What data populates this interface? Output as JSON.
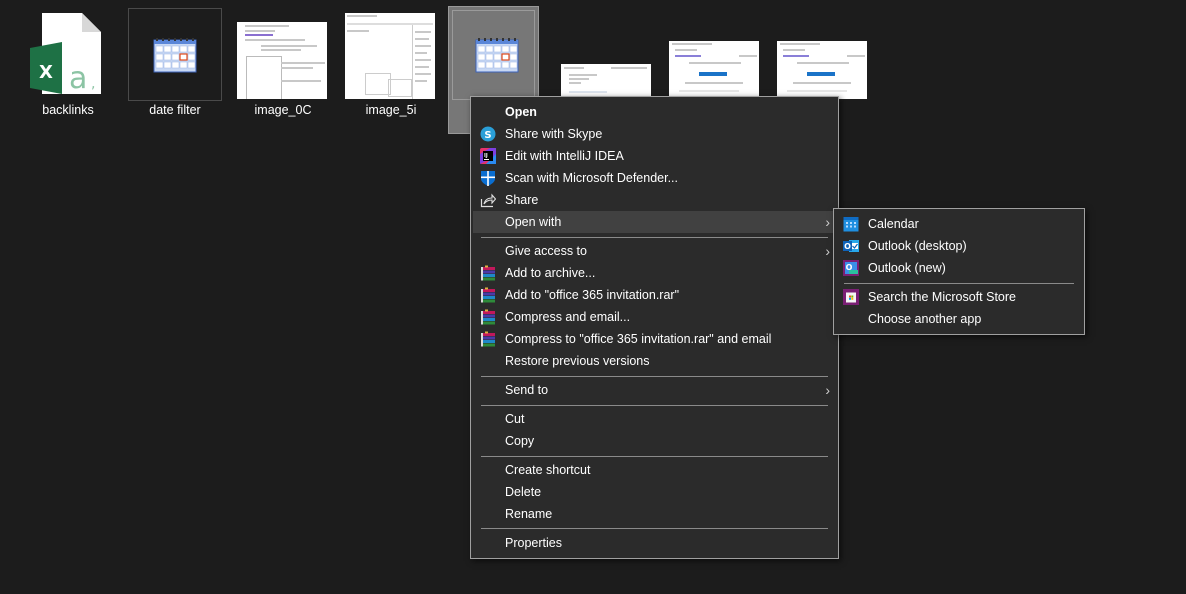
{
  "desktop": {
    "files": [
      {
        "name": "backlinks",
        "type": "excel-csv-icon"
      },
      {
        "name": "date filter",
        "type": "calendar-file-icon"
      },
      {
        "name": "image_0C",
        "type": "image-thumbnail"
      },
      {
        "name": "image_5i",
        "type": "image-thumbnail"
      },
      {
        "name": "",
        "type": "calendar-file-icon",
        "selected": true
      },
      {
        "name": "",
        "type": "image-thumbnail"
      },
      {
        "name": "",
        "type": "image-thumbnail"
      },
      {
        "name": "",
        "type": "image-thumbnail"
      }
    ]
  },
  "context_menu": {
    "items": [
      {
        "label": "Open",
        "icon": "",
        "bold": true
      },
      {
        "label": "Share with Skype",
        "icon": "skype-icon"
      },
      {
        "label": "Edit with IntelliJ IDEA",
        "icon": "intellij-icon"
      },
      {
        "label": "Scan with Microsoft Defender...",
        "icon": "defender-shield-icon"
      },
      {
        "label": "Share",
        "icon": "share-icon"
      },
      {
        "label": "Open with",
        "icon": "",
        "submenu": true,
        "highlighted": true
      },
      {
        "label": "Give access to",
        "icon": "",
        "submenu": true
      },
      {
        "label": "Add to archive...",
        "icon": "winrar-icon"
      },
      {
        "label": "Add to \"office 365 invitation.rar\"",
        "icon": "winrar-icon"
      },
      {
        "label": "Compress and email...",
        "icon": "winrar-icon"
      },
      {
        "label": "Compress to \"office 365 invitation.rar\" and email",
        "icon": "winrar-icon"
      },
      {
        "label": "Restore previous versions",
        "icon": ""
      },
      {
        "label": "Send to",
        "icon": "",
        "submenu": true
      },
      {
        "label": "Cut",
        "icon": ""
      },
      {
        "label": "Copy",
        "icon": ""
      },
      {
        "label": "Create shortcut",
        "icon": ""
      },
      {
        "label": "Delete",
        "icon": ""
      },
      {
        "label": "Rename",
        "icon": ""
      },
      {
        "label": "Properties",
        "icon": ""
      }
    ]
  },
  "open_with_submenu": {
    "items": [
      {
        "label": "Calendar",
        "icon": "calendar-app-icon"
      },
      {
        "label": "Outlook (desktop)",
        "icon": "outlook-desktop-icon"
      },
      {
        "label": "Outlook (new)",
        "icon": "outlook-new-icon"
      },
      {
        "label": "Search the Microsoft Store",
        "icon": "microsoft-store-icon"
      },
      {
        "label": "Choose another app",
        "icon": ""
      }
    ]
  },
  "colors": {
    "background": "#1c1c1c",
    "menu_bg": "#2b2b2b",
    "menu_highlight": "#414141",
    "excel_green": "#1e7145",
    "skype_blue": "#2a9fd8",
    "defender_blue": "#0a6ed1",
    "outlook_blue": "#0f63b8",
    "store_purple": "#7a1f74"
  }
}
